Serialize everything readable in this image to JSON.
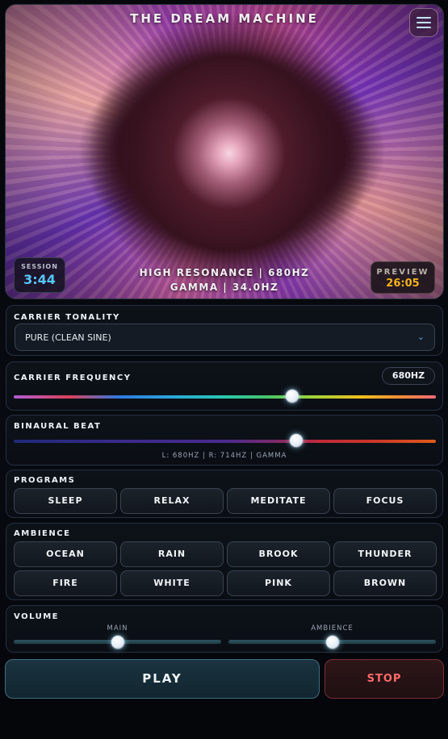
{
  "visualizer": {
    "title": "THE DREAM MACHINE",
    "session_label": "SESSION",
    "session_time": "3:44",
    "preview_label": "PREVIEW",
    "preview_time": "26:05",
    "resonance_line": "HIGH RESONANCE | 680HZ",
    "gamma_line": "GAMMA | 34.0HZ"
  },
  "carrier_tonality": {
    "title": "CARRIER TONALITY",
    "selected": "PURE (CLEAN SINE)"
  },
  "carrier_frequency": {
    "title": "CARRIER FREQUENCY",
    "value_label": "680HZ",
    "slider_fraction": 0.66
  },
  "binaural_beat": {
    "title": "BINAURAL BEAT",
    "info": "L: 680HZ | R: 714HZ | GAMMA",
    "slider_fraction": 0.67
  },
  "programs": {
    "title": "PROGRAMS",
    "items": [
      "SLEEP",
      "RELAX",
      "MEDITATE",
      "FOCUS"
    ]
  },
  "ambience": {
    "title": "AMBIENCE",
    "items": [
      "OCEAN",
      "RAIN",
      "BROOK",
      "THUNDER",
      "FIRE",
      "WHITE",
      "PINK",
      "BROWN"
    ]
  },
  "volume": {
    "title": "VOLUME",
    "main_label": "MAIN",
    "ambience_label": "AMBIENCE",
    "main_fraction": 0.5,
    "ambience_fraction": 0.5
  },
  "controls": {
    "play_label": "PLAY",
    "stop_label": "STOP"
  },
  "colors": {
    "session_time": "#57c8ff",
    "preview_time": "#f5b21a",
    "stop": "#ff6b6b"
  },
  "icons": {
    "menu": "hamburger-menu-icon",
    "select_chevron": "chevron-down-icon"
  }
}
